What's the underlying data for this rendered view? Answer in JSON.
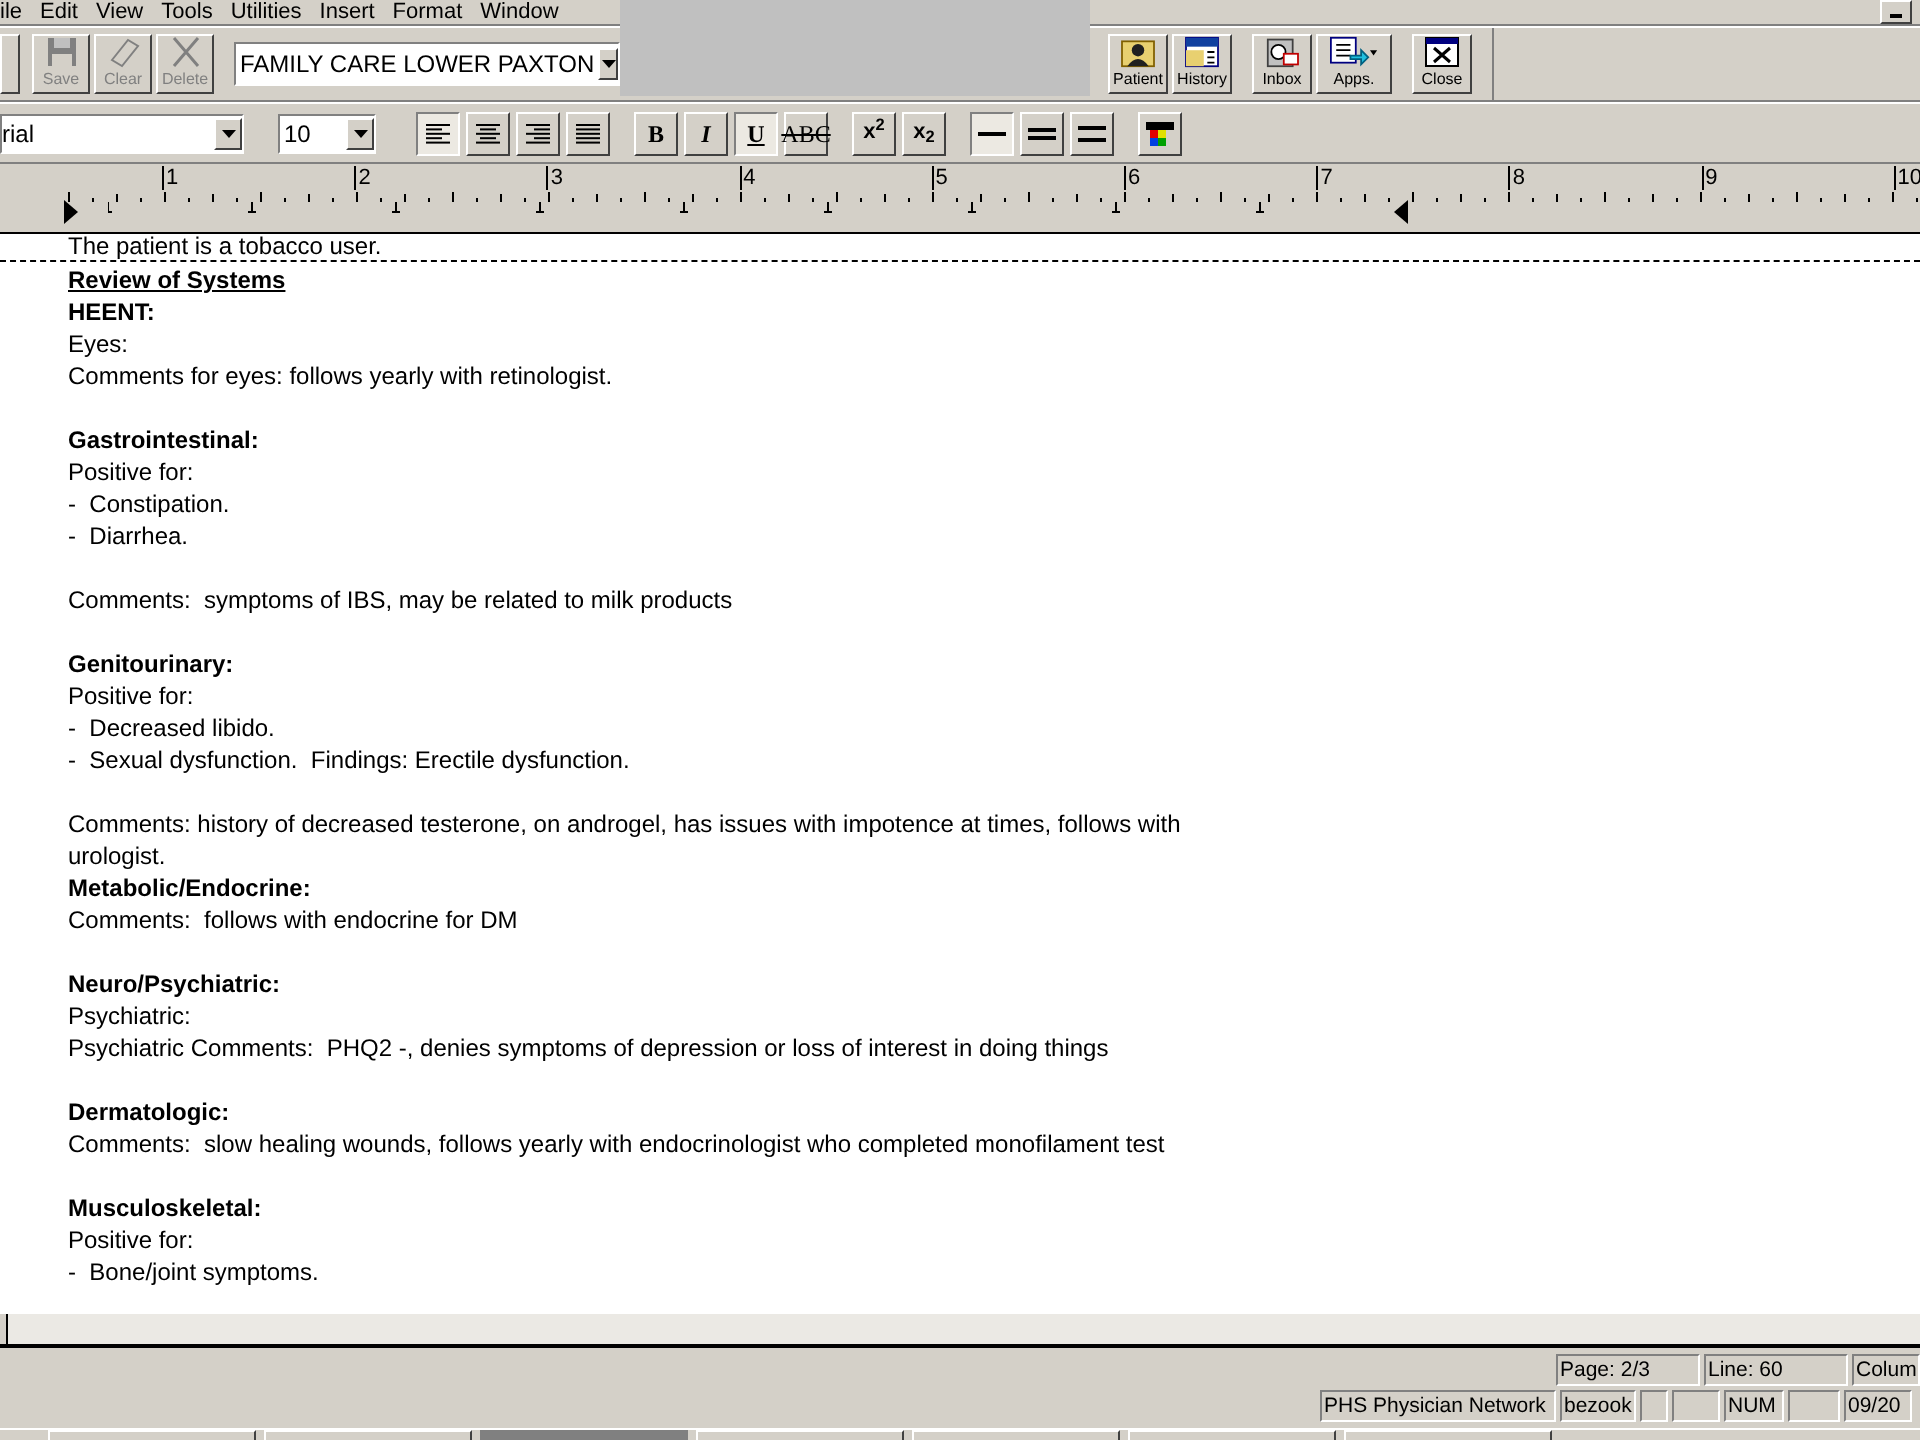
{
  "menu": [
    "ile",
    "Edit",
    "View",
    "Tools",
    "Utilities",
    "Insert",
    "Format",
    "Window"
  ],
  "toolbar": {
    "edit_buttons": [
      {
        "label": "Save",
        "disabled": true
      },
      {
        "label": "Clear",
        "disabled": true
      },
      {
        "label": "Delete",
        "disabled": true
      }
    ],
    "location": "FAMILY CARE LOWER PAXTON",
    "nav_buttons": [
      {
        "label": "Patient",
        "kind": "patient"
      },
      {
        "label": "History",
        "kind": "history"
      },
      {
        "label": "Inbox",
        "kind": "inbox"
      },
      {
        "label": "Apps.",
        "kind": "apps"
      },
      {
        "label": "Close",
        "kind": "close"
      }
    ]
  },
  "format_bar": {
    "font": "rial",
    "size": "10",
    "align": [
      {
        "kind": "left",
        "selected": true
      },
      {
        "kind": "center",
        "selected": false
      },
      {
        "kind": "right",
        "selected": false
      },
      {
        "kind": "justify",
        "selected": false
      }
    ],
    "styles": [
      {
        "label": "B",
        "kind": "bold",
        "pressed": false
      },
      {
        "label": "I",
        "kind": "italic",
        "pressed": false
      },
      {
        "label": "U",
        "kind": "underline",
        "pressed": true
      },
      {
        "label": "ABC",
        "kind": "strike",
        "pressed": false
      }
    ],
    "scripts": [
      "x$^{2}$",
      "x$_{2}$"
    ],
    "spacing": [
      {
        "kind": "single",
        "selected": true
      },
      {
        "kind": "one_half",
        "selected": false
      },
      {
        "kind": "double",
        "selected": false
      }
    ]
  },
  "ruler": [
    "1",
    "2",
    "3",
    "4",
    "5",
    "6",
    "7",
    "8",
    "9",
    "10"
  ],
  "document": {
    "cut_line": "The patient is a tobacco user.",
    "lines": [
      {
        "kind": "title",
        "text": "Review of Systems"
      },
      {
        "kind": "heading",
        "text": "HEENT:"
      },
      {
        "kind": "line",
        "text": "Eyes:"
      },
      {
        "kind": "line",
        "text": "Comments for eyes: follows yearly with retinologist."
      },
      {
        "kind": "blank"
      },
      {
        "kind": "heading",
        "text": "Gastrointestinal:"
      },
      {
        "kind": "line",
        "text": "Positive for:"
      },
      {
        "kind": "line",
        "text": "-  Constipation."
      },
      {
        "kind": "line",
        "text": "-  Diarrhea."
      },
      {
        "kind": "blank"
      },
      {
        "kind": "line",
        "text": "Comments:  symptoms of IBS, may be related to milk products"
      },
      {
        "kind": "blank"
      },
      {
        "kind": "heading",
        "text": "Genitourinary:"
      },
      {
        "kind": "line",
        "text": "Positive for:"
      },
      {
        "kind": "line",
        "text": "-  Decreased libido."
      },
      {
        "kind": "line",
        "text": "-  Sexual dysfunction.  Findings: Erectile dysfunction."
      },
      {
        "kind": "blank"
      },
      {
        "kind": "line",
        "text": "Comments: history of decreased testerone, on androgel, has issues with impotence at times, follows with urologist."
      },
      {
        "kind": "heading",
        "text": "Metabolic/Endocrine:"
      },
      {
        "kind": "line",
        "text": "Comments:  follows with endocrine for DM"
      },
      {
        "kind": "blank"
      },
      {
        "kind": "heading",
        "text": "Neuro/Psychiatric:"
      },
      {
        "kind": "line",
        "text": "Psychiatric:"
      },
      {
        "kind": "line",
        "text": "Psychiatric Comments:  PHQ2 -, denies symptoms of depression or loss of interest in doing things"
      },
      {
        "kind": "blank"
      },
      {
        "kind": "heading",
        "text": "Dermatologic:"
      },
      {
        "kind": "line",
        "text": "Comments:  slow healing wounds, follows yearly with endocrinologist who completed monofilament test"
      },
      {
        "kind": "blank"
      },
      {
        "kind": "heading",
        "text": "Musculoskeletal:"
      },
      {
        "kind": "line",
        "text": "Positive for:"
      },
      {
        "kind": "line",
        "text": "-  Bone/joint symptoms."
      }
    ]
  },
  "status_bar": {
    "row_1": [
      "Page: 2/3",
      "Line: 60",
      "Colum"
    ],
    "row_2": [
      {
        "kind": "text",
        "text": "PHS Physician Network"
      },
      {
        "kind": "text",
        "text": "bezook"
      },
      {
        "kind": "blank"
      },
      {
        "kind": "blank"
      },
      {
        "kind": "text",
        "text": "NUM"
      },
      {
        "kind": "blank"
      },
      {
        "kind": "text",
        "text": "09/20"
      }
    ]
  }
}
